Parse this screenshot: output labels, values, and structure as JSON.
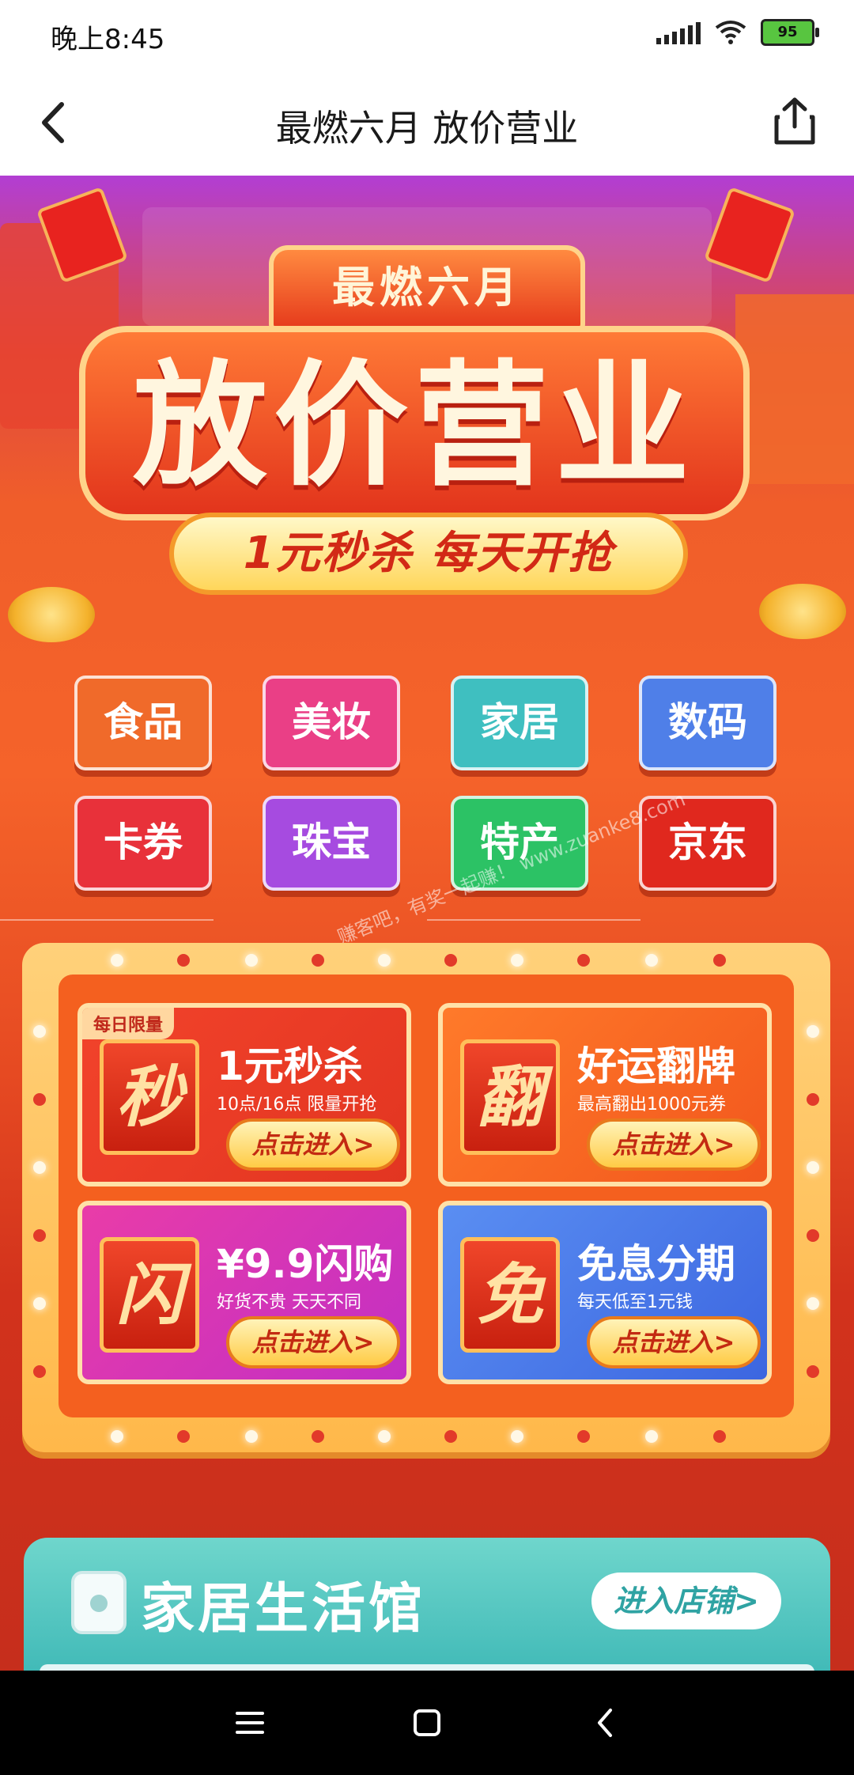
{
  "status_bar": {
    "time": "晚上8:45",
    "battery": "95"
  },
  "nav": {
    "title": "最燃六月 放价营业"
  },
  "hero": {
    "crown_text": "最燃六月",
    "main_title": "放价营业",
    "slogan": "1元秒杀 每天开抢"
  },
  "categories": [
    {
      "label": "食品",
      "color": "#f06a2a"
    },
    {
      "label": "美妆",
      "color": "#ea3f86"
    },
    {
      "label": "家居",
      "color": "#3fbfc0"
    },
    {
      "label": "数码",
      "color": "#4f7fe8"
    },
    {
      "label": "卡券",
      "color": "#e8313a"
    },
    {
      "label": "珠宝",
      "color": "#a64be0"
    },
    {
      "label": "特产",
      "color": "#2cc265"
    },
    {
      "label": "京东",
      "color": "#e0281e"
    }
  ],
  "watermark": "赚客吧，有奖一起赚！ www.zuanke8.com",
  "promos": {
    "daily_tag": "每日限量",
    "seckill": {
      "icon_char": "秒",
      "title": "1元秒杀",
      "subtitle": "10点/16点 限量开抢",
      "button": "点击进入>"
    },
    "flip": {
      "icon_char": "翻",
      "title": "好运翻牌",
      "subtitle": "最高翻出1000元券",
      "button": "点击进入>"
    },
    "flash": {
      "icon_char": "闪",
      "title": "¥9.9闪购",
      "subtitle": "好货不贵 天天不同",
      "button": "点击进入>"
    },
    "installment": {
      "icon_char": "免",
      "title": "免息分期",
      "subtitle": "每天低至1元钱",
      "button": "点击进入>"
    }
  },
  "shop_section": {
    "title": "家居生活馆",
    "button": "进入店铺>"
  },
  "colors": {
    "banner_top": "#b23ed3",
    "banner_main": "#f05e2a",
    "gold": "#ffd38a",
    "teal": "#39b5b4"
  }
}
